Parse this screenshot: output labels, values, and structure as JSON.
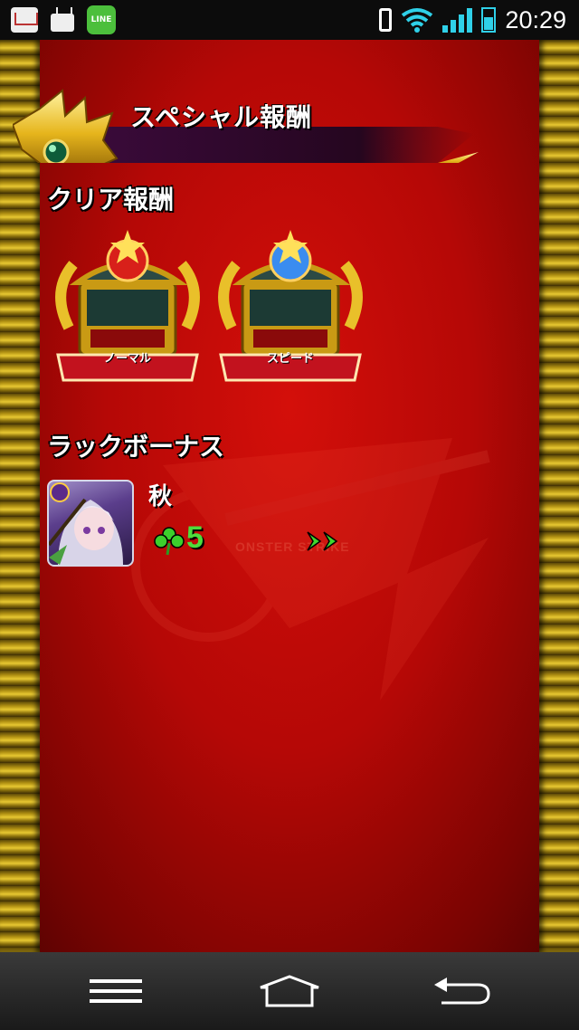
{
  "status_bar": {
    "time": "20:29",
    "notif_line_label": "LINE",
    "icons": [
      "mail-icon",
      "tv-icon",
      "line-app-icon",
      "vibrate-icon",
      "wifi-icon",
      "signal-icon",
      "battery-icon"
    ],
    "accent_color": "#2fd0e8"
  },
  "banner": {
    "title": "スペシャル報酬"
  },
  "clear_reward": {
    "heading": "クリア報酬",
    "chests": [
      {
        "label": "ノーマル",
        "gem_color": "#d8201a",
        "icon": "treasure-chest-icon"
      },
      {
        "label": "スピード",
        "gem_color": "#3a8cf0",
        "icon": "treasure-chest-icon"
      }
    ]
  },
  "luck_bonus": {
    "heading": "ラックボーナス",
    "character_name": "秋",
    "luck": "5",
    "luck_color": "#4ddc3c"
  },
  "watermark": {
    "text": "ONSTER STRIKE"
  },
  "nav_bar": {
    "buttons": [
      "menu-button",
      "home-button",
      "back-button"
    ]
  }
}
